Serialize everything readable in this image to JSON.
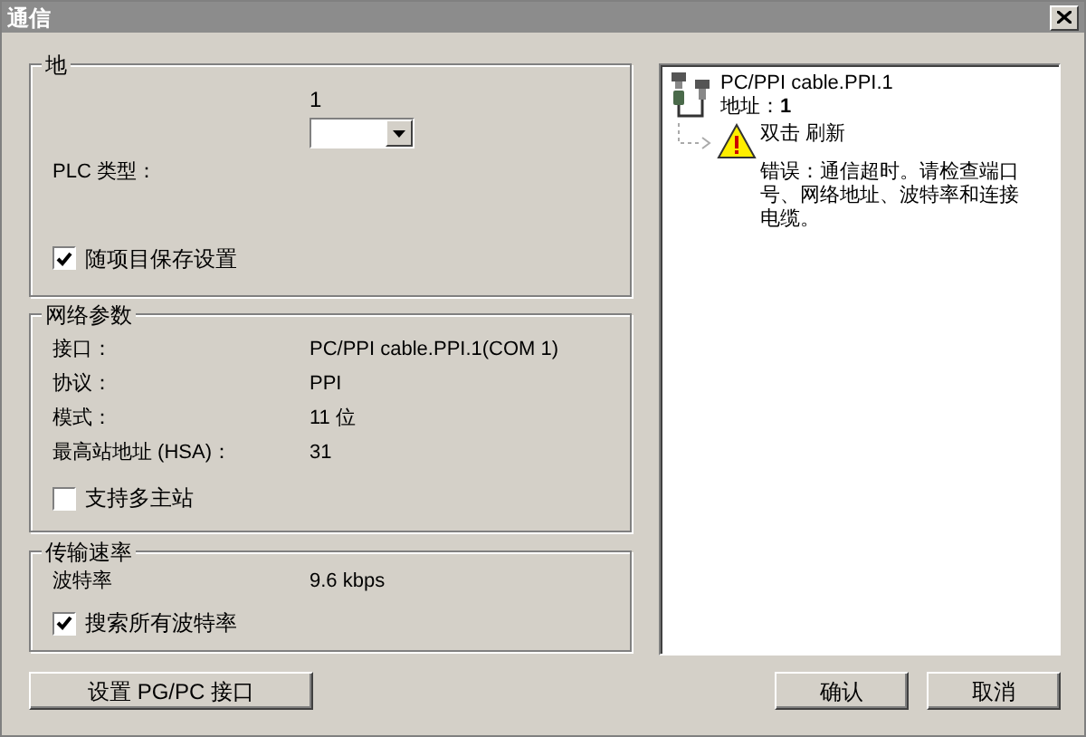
{
  "window": {
    "title": "通信"
  },
  "address_group": {
    "title": "地",
    "value": "1",
    "plc_type_label": "PLC 类型：",
    "save_setting": {
      "label": "随项目保存设置",
      "checked": true
    }
  },
  "network_group": {
    "title": "网络参数",
    "rows": [
      {
        "label": "接口：",
        "value": "PC/PPI cable.PPI.1(COM 1)"
      },
      {
        "label": "协议：",
        "value": "PPI"
      },
      {
        "label": "模式：",
        "value": "11 位"
      },
      {
        "label": "最高站地址 (HSA)：",
        "value": "31"
      }
    ],
    "multi_master": {
      "label": "支持多主站",
      "checked": false
    }
  },
  "rate_group": {
    "title": "传输速率",
    "rows": [
      {
        "label": "波特率",
        "value": "9.6 kbps"
      }
    ],
    "search_all": {
      "label": "搜索所有波特率",
      "checked": true
    }
  },
  "setup_button": "设置 PG/PC 接口",
  "device_panel": {
    "device_name": "PC/PPI cable.PPI.1",
    "address": "地址：**1**",
    "action": "双击 刷新",
    "error": "错误：通信超时。请检查端口号、网络地址、波特率和连接电缆。"
  },
  "buttons": [
    "确认",
    "取消"
  ]
}
